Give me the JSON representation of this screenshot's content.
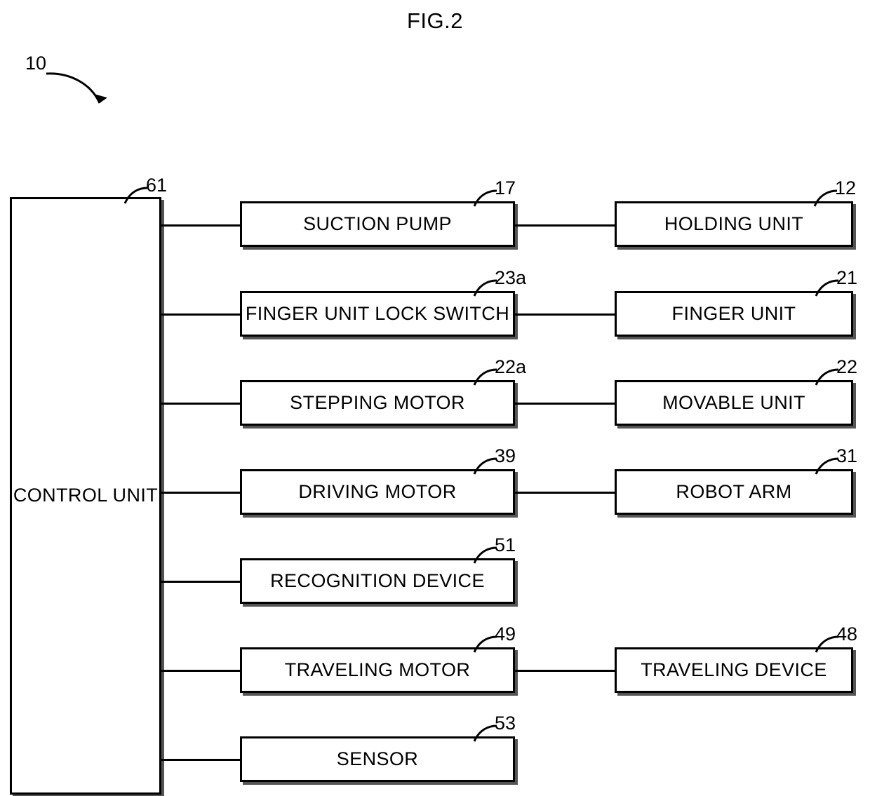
{
  "figure": {
    "title": "FIG.2",
    "system_ref": "10"
  },
  "control_unit": {
    "label": "CONTROL UNIT",
    "ref": "61"
  },
  "rows": [
    {
      "middle": {
        "label": "SUCTION PUMP",
        "ref": "17"
      },
      "right": {
        "label": "HOLDING UNIT",
        "ref": "12"
      }
    },
    {
      "middle": {
        "label": "FINGER UNIT LOCK SWITCH",
        "ref": "23a"
      },
      "right": {
        "label": "FINGER UNIT",
        "ref": "21"
      }
    },
    {
      "middle": {
        "label": "STEPPING MOTOR",
        "ref": "22a"
      },
      "right": {
        "label": "MOVABLE UNIT",
        "ref": "22"
      }
    },
    {
      "middle": {
        "label": "DRIVING MOTOR",
        "ref": "39"
      },
      "right": {
        "label": "ROBOT ARM",
        "ref": "31"
      }
    },
    {
      "middle": {
        "label": "RECOGNITION DEVICE",
        "ref": "51"
      },
      "right": null
    },
    {
      "middle": {
        "label": "TRAVELING MOTOR",
        "ref": "49"
      },
      "right": {
        "label": "TRAVELING DEVICE",
        "ref": "48"
      }
    },
    {
      "middle": {
        "label": "SENSOR",
        "ref": "53"
      },
      "right": null
    }
  ]
}
